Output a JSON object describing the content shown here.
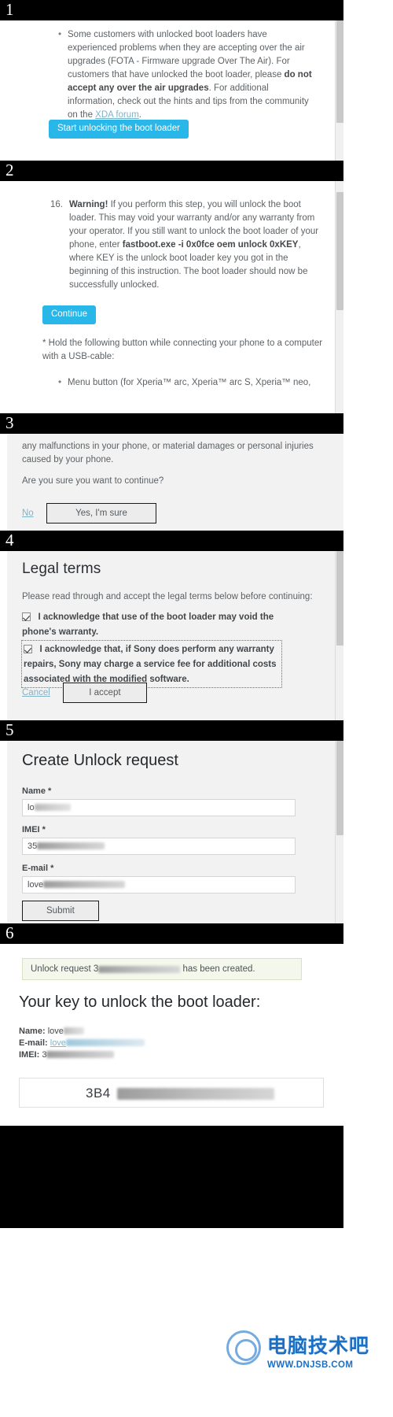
{
  "panels": [
    {
      "number": "1",
      "bullet": "Some customers with unlocked boot loaders have experienced problems when they are accepting over the air upgrades (FOTA - Firmware upgrade Over The Air). For customers that have unlocked the boot loader, please ",
      "bullet_bold": "do not accept any over the air upgrades",
      "bullet_tail": ". For additional information, check out the hints and tips from the community on the ",
      "link_label": "XDA forum",
      "bullet_end": ".",
      "button_label": "Start unlocking the boot loader"
    },
    {
      "number": "2",
      "step_number": "16.",
      "warning_label": "Warning!",
      "step_text_1": " If you perform this step, you will unlock the boot loader. This may void your warranty and/or any warranty from your operator. If you still want to unlock the boot loader of your phone, enter ",
      "command": "fastboot.exe -i 0x0fce oem unlock 0xKEY",
      "step_text_2": ", where KEY is the unlock boot loader key you got in the beginning of this instruction. The boot loader should now be successfully unlocked.",
      "button_label": "Continue",
      "footnote": "* Hold the following button while connecting your phone to a computer with a USB-cable:",
      "footnote_bullet": "Menu button (for Xperia™ arc, Xperia™ arc S, Xperia™ neo,"
    },
    {
      "number": "3",
      "text_top": "any malfunctions in your phone, or material damages or personal injuries caused by your phone.",
      "question": "Are you sure you want to continue?",
      "link_label": "No",
      "button_label": "Yes, I'm sure"
    },
    {
      "number": "4",
      "title": "Legal terms",
      "intro": "Please read through and accept the legal terms below before continuing:",
      "checkbox_1": "I acknowledge that use of the boot loader may void the phone's warranty.",
      "checkbox_2": "I acknowledge that, if Sony does perform any warranty repairs, Sony may charge a service fee for additional costs associated with the modified software.",
      "link_label": "Cancel",
      "button_label": "I accept"
    },
    {
      "number": "5",
      "title": "Create Unlock request",
      "fields": [
        {
          "label": "Name *",
          "value": "lo"
        },
        {
          "label": "IMEI *",
          "value": "35"
        },
        {
          "label": "E-mail *",
          "value": "love"
        }
      ],
      "button_label": "Submit"
    },
    {
      "number": "6",
      "notice_prefix": "Unlock request 3",
      "notice_suffix": " has been created.",
      "title": "Your key to unlock the boot loader:",
      "kv": [
        {
          "label": "Name:",
          "value": "love"
        },
        {
          "label": "E-mail:",
          "value": "love"
        },
        {
          "label": "IMEI:",
          "value": "3"
        }
      ],
      "key_value": "3B4"
    }
  ],
  "watermark": {
    "main": "电脑技术吧",
    "sub": "WWW.DNJSB.COM"
  }
}
